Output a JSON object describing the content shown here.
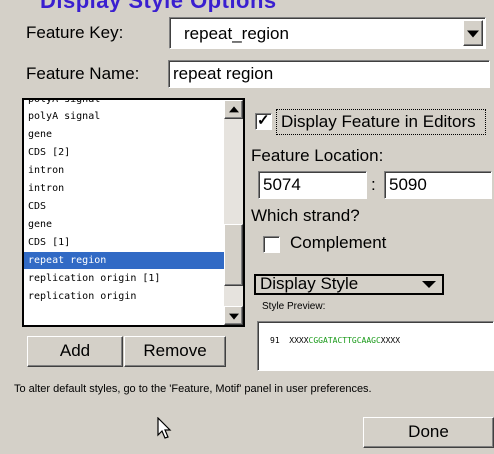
{
  "fields": {
    "feature_key": {
      "label": "Feature Key:",
      "value": "repeat_region"
    },
    "feature_name": {
      "label": "Feature Name:",
      "value": "repeat region"
    }
  },
  "feature_list": {
    "items": [
      {
        "label": "polyA signal",
        "selected": false
      },
      {
        "label": "polyA signal",
        "selected": false
      },
      {
        "label": "gene",
        "selected": false
      },
      {
        "label": "CDS [2]",
        "selected": false
      },
      {
        "label": "intron",
        "selected": false
      },
      {
        "label": "intron",
        "selected": false
      },
      {
        "label": "CDS",
        "selected": false
      },
      {
        "label": "gene",
        "selected": false
      },
      {
        "label": "CDS [1]",
        "selected": false
      },
      {
        "label": "repeat region",
        "selected": true
      },
      {
        "label": "replication origin [1]",
        "selected": false
      },
      {
        "label": "replication origin",
        "selected": false
      }
    ],
    "selection_color": "#316ac5"
  },
  "display_in_editors": {
    "label": "Display Feature in Editors",
    "checked": true
  },
  "location": {
    "label": "Feature Location:",
    "start": "5074",
    "separator": ":",
    "end": "5090"
  },
  "strand": {
    "label": "Which strand?",
    "complement_label": "Complement",
    "complement_checked": false
  },
  "style": {
    "select_label": "Display Style",
    "preview_label": "Style Preview:",
    "preview": {
      "position": "91",
      "prefix": "XXXX",
      "highlight": "CGGATACTTGCAAGC",
      "suffix": "XXXX",
      "highlight_color": "#1a9a1a"
    }
  },
  "buttons": {
    "add": "Add",
    "remove": "Remove",
    "done": "Done"
  },
  "hint": "To alter default styles, go to the 'Feature, Motif' panel in user preferences."
}
